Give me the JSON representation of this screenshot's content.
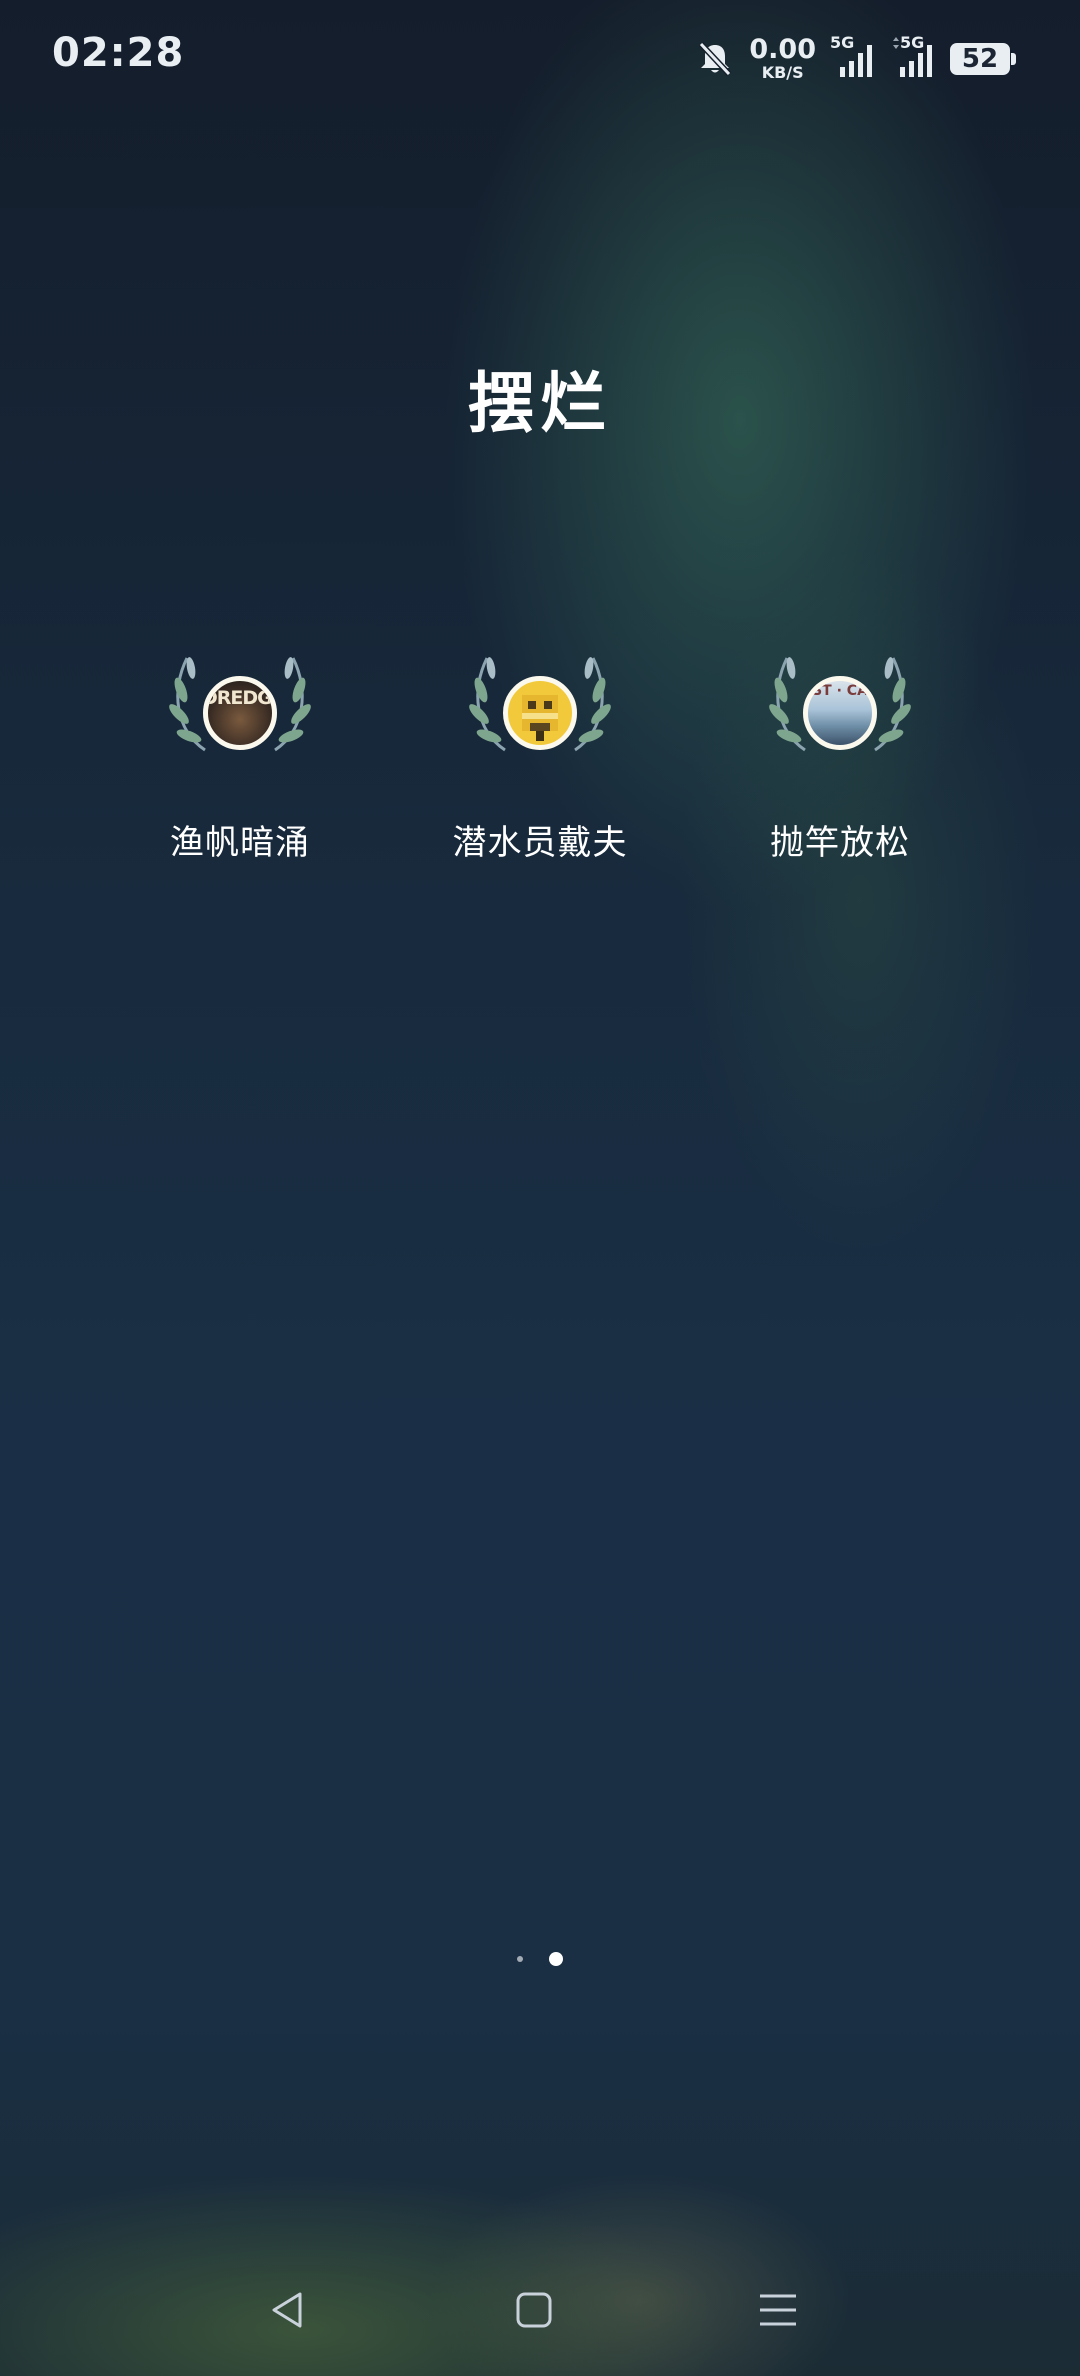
{
  "status_bar": {
    "time": "02:28",
    "net_speed_value": "0.00",
    "net_speed_unit": "KB/S",
    "sim1_tag": "5G",
    "sim2_tag": "5G",
    "battery_level": "52",
    "icons": [
      "bell-off-icon",
      "signal-icon",
      "signal-icon",
      "battery-icon"
    ]
  },
  "folder": {
    "title": "摆烂",
    "apps": [
      {
        "label": "渔帆暗涌",
        "icon_text": "DREDGE",
        "icon": "dredge-app-icon"
      },
      {
        "label": "潜水员戴夫",
        "icon_text": "",
        "icon": "dave-app-icon"
      },
      {
        "label": "抛竿放松",
        "icon_text": "ST · CA",
        "icon": "cast-app-icon"
      }
    ]
  },
  "pager": {
    "page_count": 2,
    "current_page": 2
  },
  "nav_bar": {
    "icons": [
      "back-icon",
      "home-icon",
      "recents-icon"
    ]
  }
}
